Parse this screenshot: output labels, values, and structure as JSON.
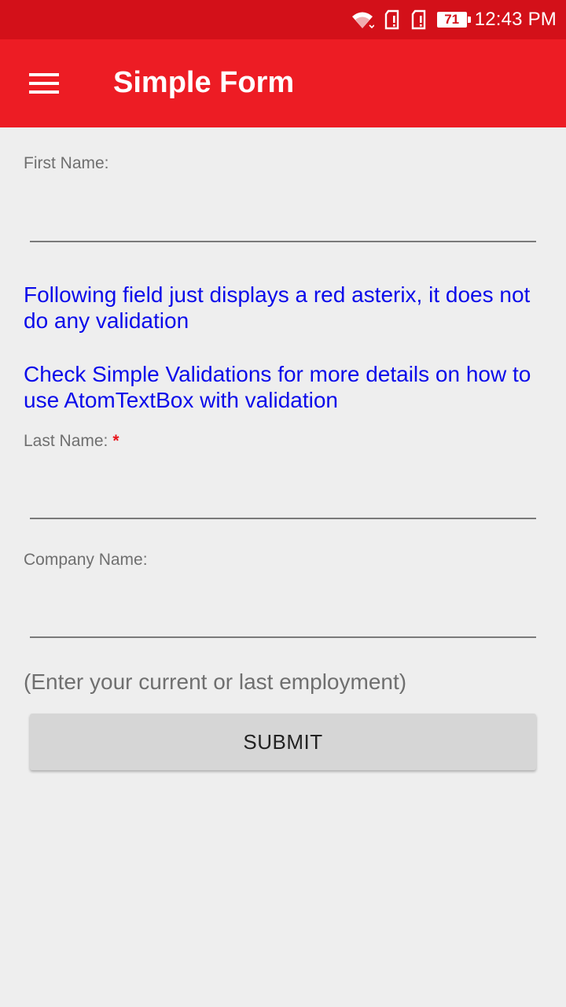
{
  "status_bar": {
    "battery": "71",
    "time": "12:43 PM",
    "icons": [
      "wifi-icon",
      "sim-card-icon",
      "sim-card-icon",
      "battery-icon"
    ]
  },
  "app_bar": {
    "title": "Simple Form",
    "menu_icon": "hamburger-menu-icon"
  },
  "form": {
    "first_name_label": "First Name:",
    "first_name_value": "",
    "info_line1": "Following field just displays a red asterix, it does not do any validation",
    "info_line2": "Check Simple Validations for more details on how to use AtomTextBox with validation",
    "last_name_label": "Last Name:",
    "required_mark": "*",
    "last_name_value": "",
    "company_name_label": "Company Name:",
    "company_name_value": "",
    "company_hint": "(Enter your current or last employment)",
    "submit_label": "SUBMIT"
  },
  "colors": {
    "status_bar": "#d31019",
    "app_bar": "#ed1c24",
    "info_text": "#0b0bea",
    "required": "#e8161c"
  }
}
